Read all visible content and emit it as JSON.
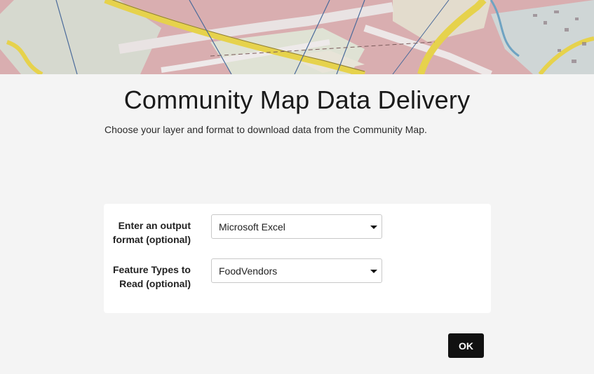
{
  "header": {
    "title": "Community Map Data Delivery",
    "subtitle": "Choose your layer and format to download data from the Community Map."
  },
  "form": {
    "output_format": {
      "label_line1": "Enter an output",
      "label_line2": "format (optional)",
      "value": "Microsoft Excel"
    },
    "feature_types": {
      "label_line1": "Feature Types to",
      "label_line2": "Read (optional)",
      "value": "FoodVendors"
    }
  },
  "actions": {
    "ok_label": "OK"
  },
  "colors": {
    "page_bg": "#f4f4f4",
    "card_bg": "#ffffff",
    "button_bg": "#111111",
    "banner_map_pink": "#d9a6a8",
    "banner_map_yellow": "#e8d24a"
  },
  "icons": {
    "select_caret": "caret-down-icon"
  }
}
